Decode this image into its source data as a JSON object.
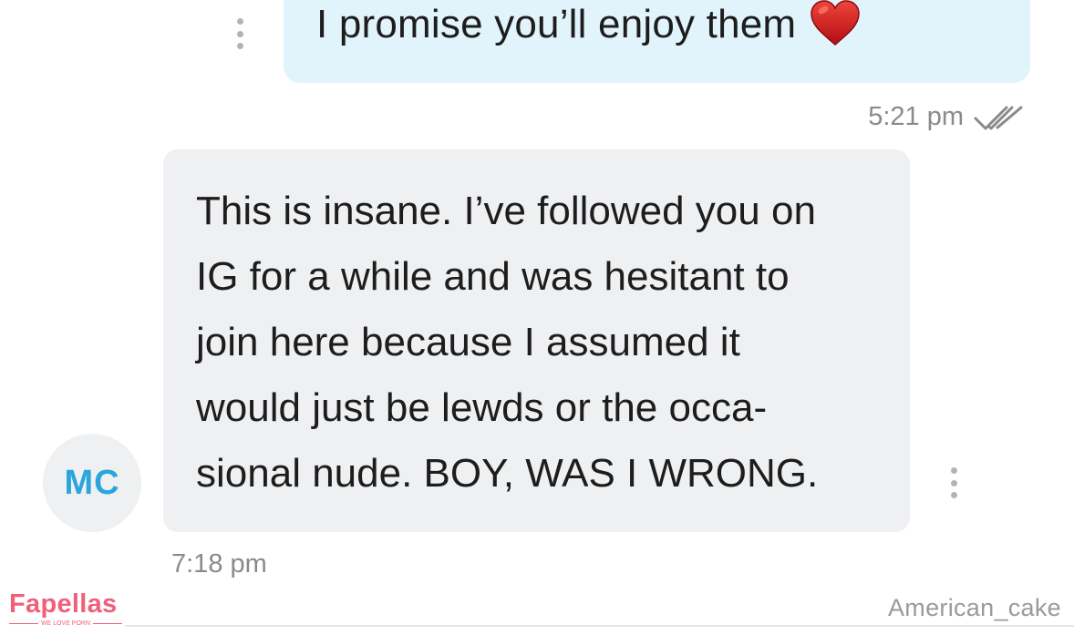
{
  "sent_message": {
    "text": "I promise you’ll enjoy them",
    "emoji": "heart-emoji",
    "time": "5:21 pm",
    "status_icon": "double-check-icon"
  },
  "received_message": {
    "text": "This is insane. I’ve followed you on\nIG for a while and was hesitant to\njoin here because I assumed it\nwould just be lewds or the occa-\nsional nude. BOY, WAS I WRONG.",
    "time": "7:18 pm",
    "sender_initials": "MC"
  },
  "watermark": {
    "brand": "Fapellas",
    "tagline": "WE LOVE PORN",
    "username": "American_cake"
  },
  "colors": {
    "sent_bubble": "#e1f3fb",
    "received_bubble": "#eff0f2",
    "avatar_text": "#2aa6dc",
    "timestamp": "#8a8a8a",
    "brand": "#f0607a"
  }
}
